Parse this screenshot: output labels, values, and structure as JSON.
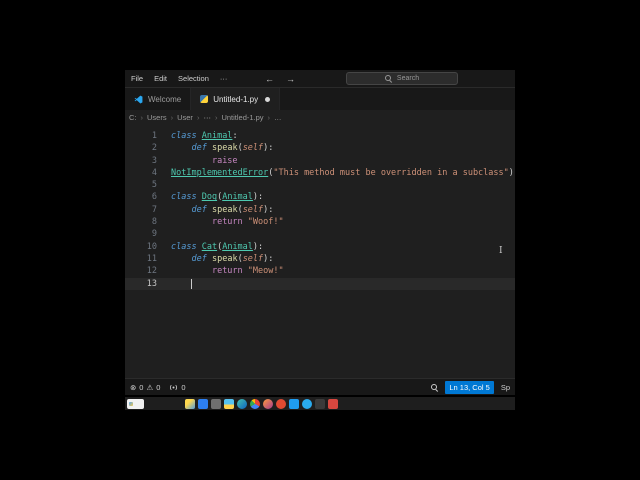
{
  "icons": {
    "error": "⊗",
    "warning": "⚠",
    "breadcrumb_separator": "›"
  },
  "syntax_colors": {
    "keyword": "#569cd6",
    "control": "#c586c0",
    "class_name": "#4ec9b0",
    "function": "#dcdcaa",
    "self_param": "#ce9178",
    "string": "#ce9178",
    "punctuation": "#d4d4d4"
  },
  "titlebar": {
    "menu_items": [
      "File",
      "Edit",
      "Selection",
      "···"
    ],
    "nav_back": "←",
    "nav_forward": "→",
    "search_placeholder": "Search"
  },
  "tabs": [
    {
      "label": "Welcome",
      "icon": "vscode-logo",
      "active": false,
      "modified": false
    },
    {
      "label": "Untitled-1.py",
      "icon": "python",
      "active": true,
      "modified": true
    }
  ],
  "breadcrumb": [
    "C:",
    "Users",
    "User",
    "⋯",
    "Untitled-1.py",
    "…"
  ],
  "editor": {
    "active_line": 13,
    "cursor_col": 5,
    "lines": [
      {
        "n": "1",
        "tokens": [
          [
            "kw",
            "class "
          ],
          [
            "cls",
            "Animal"
          ],
          [
            "pn",
            ":"
          ]
        ]
      },
      {
        "n": "2",
        "tokens": [
          [
            "pn",
            "    "
          ],
          [
            "kw",
            "def "
          ],
          [
            "fn",
            "speak"
          ],
          [
            "pn",
            "("
          ],
          [
            "slf",
            "self"
          ],
          [
            "pn",
            "):"
          ]
        ]
      },
      {
        "n": "3",
        "tokens": [
          [
            "pn",
            "        "
          ],
          [
            "ctl",
            "raise"
          ]
        ]
      },
      {
        "n": "4",
        "tokens": [
          [
            "cls",
            "NotImplementedError"
          ],
          [
            "pn",
            "("
          ],
          [
            "str",
            "\"This method must be overridden in a subclass\""
          ],
          [
            "pn",
            ")"
          ]
        ]
      },
      {
        "n": "5",
        "tokens": []
      },
      {
        "n": "6",
        "tokens": [
          [
            "kw",
            "class "
          ],
          [
            "cls",
            "Dog"
          ],
          [
            "pn",
            "("
          ],
          [
            "cls",
            "Animal"
          ],
          [
            "pn",
            "):"
          ]
        ]
      },
      {
        "n": "7",
        "tokens": [
          [
            "pn",
            "    "
          ],
          [
            "kw",
            "def "
          ],
          [
            "fn",
            "speak"
          ],
          [
            "pn",
            "("
          ],
          [
            "slf",
            "self"
          ],
          [
            "pn",
            "):"
          ]
        ]
      },
      {
        "n": "8",
        "tokens": [
          [
            "pn",
            "        "
          ],
          [
            "ctl",
            "return "
          ],
          [
            "str",
            "\"Woof!\""
          ]
        ]
      },
      {
        "n": "9",
        "tokens": []
      },
      {
        "n": "10",
        "tokens": [
          [
            "kw",
            "class "
          ],
          [
            "cls",
            "Cat"
          ],
          [
            "pn",
            "("
          ],
          [
            "cls",
            "Animal"
          ],
          [
            "pn",
            "):"
          ]
        ]
      },
      {
        "n": "11",
        "tokens": [
          [
            "pn",
            "    "
          ],
          [
            "kw",
            "def "
          ],
          [
            "fn",
            "speak"
          ],
          [
            "pn",
            "("
          ],
          [
            "slf",
            "self"
          ],
          [
            "pn",
            "):"
          ]
        ]
      },
      {
        "n": "12",
        "tokens": [
          [
            "pn",
            "        "
          ],
          [
            "ctl",
            "return "
          ],
          [
            "str",
            "\"Meow!\""
          ]
        ]
      },
      {
        "n": "13",
        "tokens": [
          [
            "pn",
            "    "
          ]
        ]
      }
    ]
  },
  "statusbar": {
    "errors": "0",
    "warnings": "0",
    "broadcast_count": "0",
    "cursor_position": "Ln 13, Col 5",
    "indentation": "Sp",
    "position_bg": "#0078d4"
  },
  "taskbar": {
    "icons": [
      {
        "name": "weather-icon",
        "shape": "square",
        "bg": "linear-gradient(135deg,#ffd84d 35%,#4f9be0)"
      },
      {
        "name": "store-icon",
        "shape": "square",
        "bg": "#2d7ff0"
      },
      {
        "name": "settings-icon",
        "shape": "square",
        "bg": "#6f6f6f"
      },
      {
        "name": "file-explorer-icon",
        "shape": "square",
        "bg": "linear-gradient(180deg,#55c3f2 55%,#ffd34f 55%)"
      },
      {
        "name": "edge-icon",
        "shape": "circle",
        "bg": "linear-gradient(135deg,#46c3ae,#0b63c4)"
      },
      {
        "name": "chrome-icon",
        "shape": "circle",
        "bg": "conic-gradient(#ea4335 0 33%,#4285f4 33% 66%,#34a853 66% 88%,#fbbc05 88%)"
      },
      {
        "name": "firefox-icon",
        "shape": "circle",
        "bg": "linear-gradient(135deg,#ff9a3c,#a23b8f)"
      },
      {
        "name": "brave-icon",
        "shape": "circle",
        "bg": "#df4a32"
      },
      {
        "name": "vscode-icon",
        "shape": "square",
        "bg": "#1f9cf0"
      },
      {
        "name": "telegram-icon",
        "shape": "circle",
        "bg": "#2aabee"
      },
      {
        "name": "terminal-icon",
        "shape": "square",
        "bg": "#3a3a3a"
      },
      {
        "name": "mail-icon",
        "shape": "square",
        "bg": "#d6473f"
      }
    ]
  }
}
